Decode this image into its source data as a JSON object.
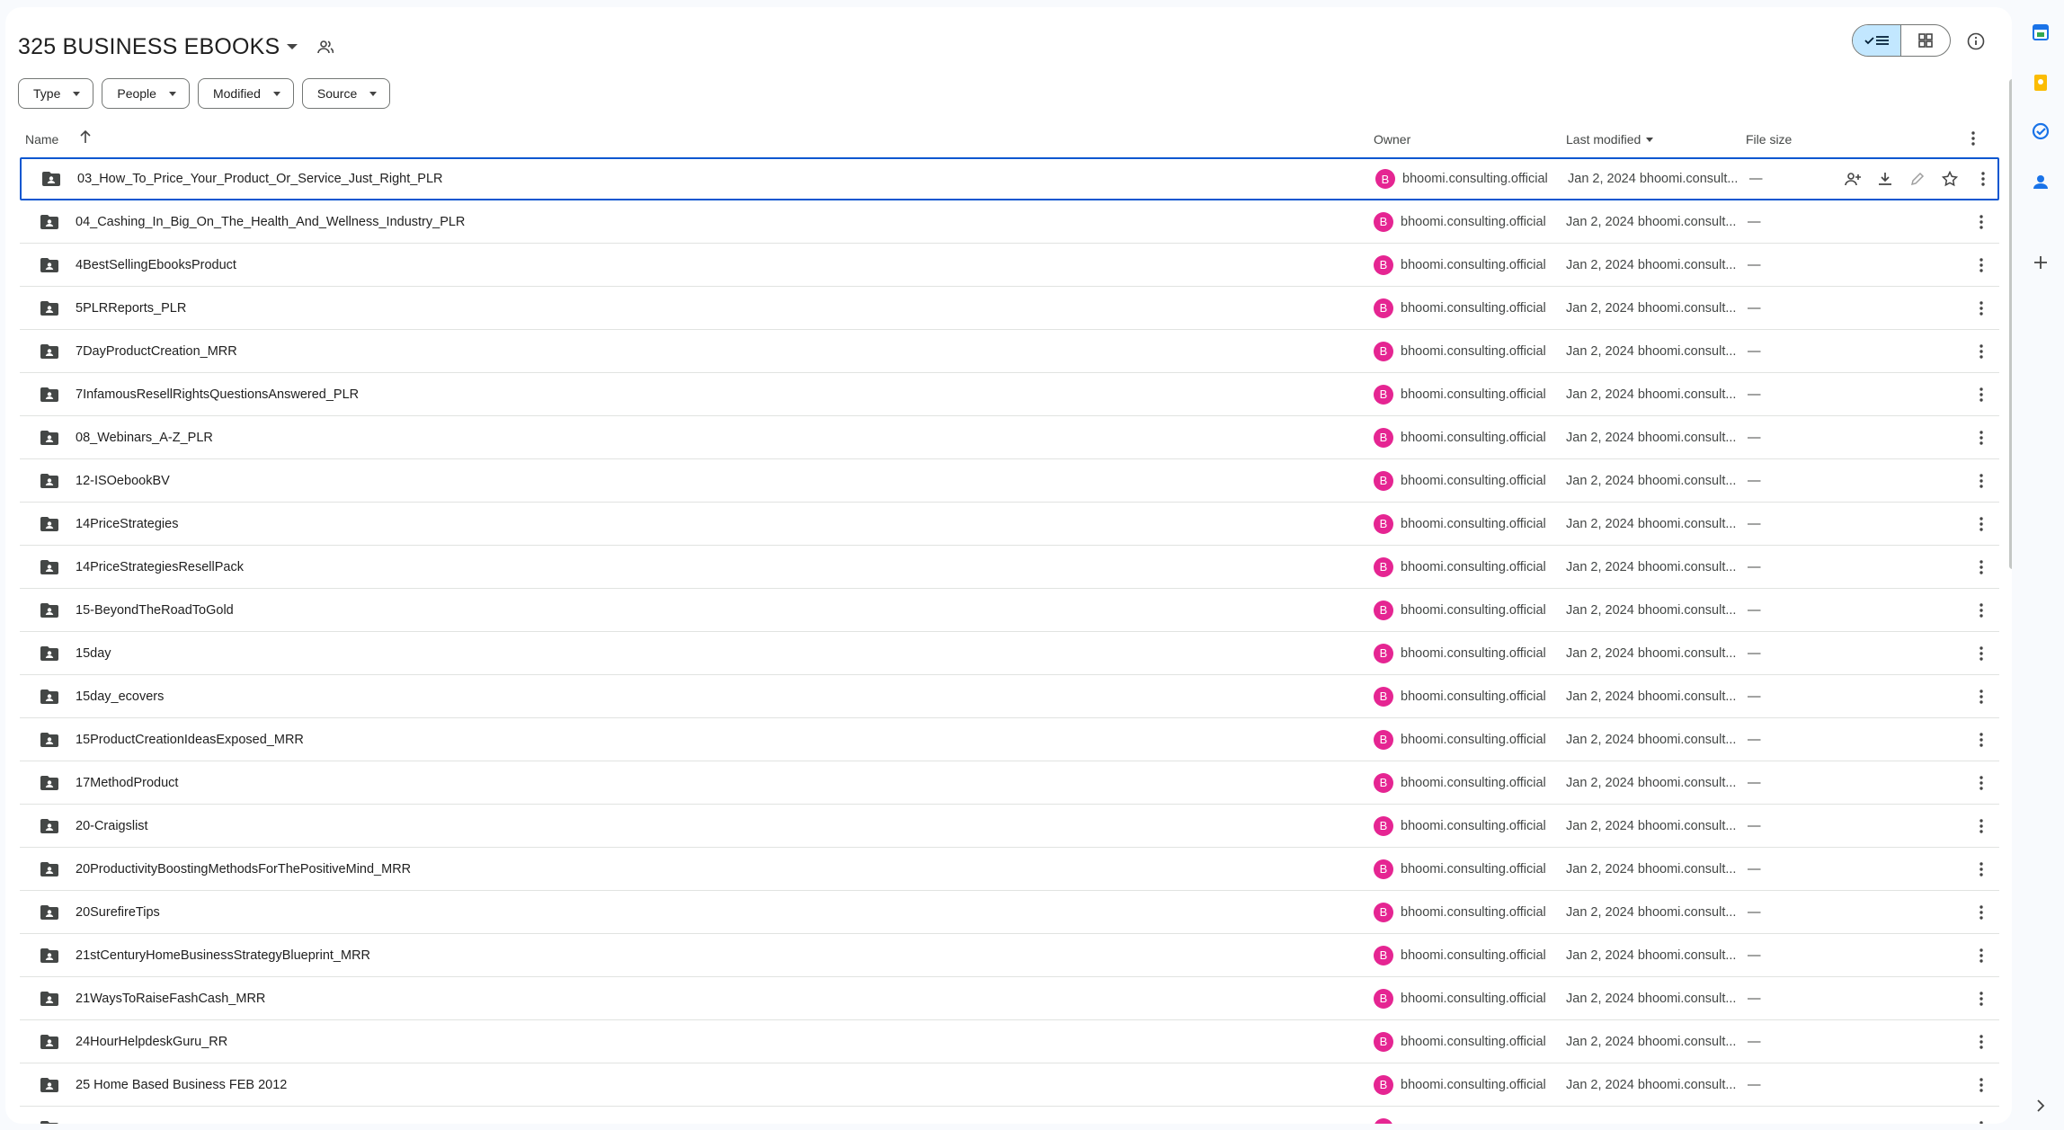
{
  "header": {
    "title": "325 BUSINESS EBOOKS"
  },
  "filters": [
    {
      "label": "Type"
    },
    {
      "label": "People"
    },
    {
      "label": "Modified"
    },
    {
      "label": "Source"
    }
  ],
  "columns": {
    "name": "Name",
    "owner": "Owner",
    "modified": "Last modified",
    "size": "File size"
  },
  "rows": [
    {
      "name": "03_How_To_Price_Your_Product_Or_Service_Just_Right_PLR",
      "avatar": "B",
      "owner": "bhoomi.consulting.official",
      "modified": "Jan 2, 2024 bhoomi.consult...",
      "size": "—"
    },
    {
      "name": "04_Cashing_In_Big_On_The_Health_And_Wellness_Industry_PLR",
      "avatar": "B",
      "owner": "bhoomi.consulting.official",
      "modified": "Jan 2, 2024 bhoomi.consult...",
      "size": "—"
    },
    {
      "name": "4BestSellingEbooksProduct",
      "avatar": "B",
      "owner": "bhoomi.consulting.official",
      "modified": "Jan 2, 2024 bhoomi.consult...",
      "size": "—"
    },
    {
      "name": "5PLRReports_PLR",
      "avatar": "B",
      "owner": "bhoomi.consulting.official",
      "modified": "Jan 2, 2024 bhoomi.consult...",
      "size": "—"
    },
    {
      "name": "7DayProductCreation_MRR",
      "avatar": "B",
      "owner": "bhoomi.consulting.official",
      "modified": "Jan 2, 2024 bhoomi.consult...",
      "size": "—"
    },
    {
      "name": "7InfamousResellRightsQuestionsAnswered_PLR",
      "avatar": "B",
      "owner": "bhoomi.consulting.official",
      "modified": "Jan 2, 2024 bhoomi.consult...",
      "size": "—"
    },
    {
      "name": "08_Webinars_A-Z_PLR",
      "avatar": "B",
      "owner": "bhoomi.consulting.official",
      "modified": "Jan 2, 2024 bhoomi.consult...",
      "size": "—"
    },
    {
      "name": "12-ISOebookBV",
      "avatar": "B",
      "owner": "bhoomi.consulting.official",
      "modified": "Jan 2, 2024 bhoomi.consult...",
      "size": "—"
    },
    {
      "name": "14PriceStrategies",
      "avatar": "B",
      "owner": "bhoomi.consulting.official",
      "modified": "Jan 2, 2024 bhoomi.consult...",
      "size": "—"
    },
    {
      "name": "14PriceStrategiesResellPack",
      "avatar": "B",
      "owner": "bhoomi.consulting.official",
      "modified": "Jan 2, 2024 bhoomi.consult...",
      "size": "—"
    },
    {
      "name": "15-BeyondTheRoadToGold",
      "avatar": "B",
      "owner": "bhoomi.consulting.official",
      "modified": "Jan 2, 2024 bhoomi.consult...",
      "size": "—"
    },
    {
      "name": "15day",
      "avatar": "B",
      "owner": "bhoomi.consulting.official",
      "modified": "Jan 2, 2024 bhoomi.consult...",
      "size": "—"
    },
    {
      "name": "15day_ecovers",
      "avatar": "B",
      "owner": "bhoomi.consulting.official",
      "modified": "Jan 2, 2024 bhoomi.consult...",
      "size": "—"
    },
    {
      "name": "15ProductCreationIdeasExposed_MRR",
      "avatar": "B",
      "owner": "bhoomi.consulting.official",
      "modified": "Jan 2, 2024 bhoomi.consult...",
      "size": "—"
    },
    {
      "name": "17MethodProduct",
      "avatar": "B",
      "owner": "bhoomi.consulting.official",
      "modified": "Jan 2, 2024 bhoomi.consult...",
      "size": "—"
    },
    {
      "name": "20-Craigslist",
      "avatar": "B",
      "owner": "bhoomi.consulting.official",
      "modified": "Jan 2, 2024 bhoomi.consult...",
      "size": "—"
    },
    {
      "name": "20ProductivityBoostingMethodsForThePositiveMind_MRR",
      "avatar": "B",
      "owner": "bhoomi.consulting.official",
      "modified": "Jan 2, 2024 bhoomi.consult...",
      "size": "—"
    },
    {
      "name": "20SurefireTips",
      "avatar": "B",
      "owner": "bhoomi.consulting.official",
      "modified": "Jan 2, 2024 bhoomi.consult...",
      "size": "—"
    },
    {
      "name": "21stCenturyHomeBusinessStrategyBlueprint_MRR",
      "avatar": "B",
      "owner": "bhoomi.consulting.official",
      "modified": "Jan 2, 2024 bhoomi.consult...",
      "size": "—"
    },
    {
      "name": "21WaysToRaiseFashCash_MRR",
      "avatar": "B",
      "owner": "bhoomi.consulting.official",
      "modified": "Jan 2, 2024 bhoomi.consult...",
      "size": "—"
    },
    {
      "name": "24HourHelpdeskGuru_RR",
      "avatar": "B",
      "owner": "bhoomi.consulting.official",
      "modified": "Jan 2, 2024 bhoomi.consult...",
      "size": "—"
    },
    {
      "name": "25 Home Based Business FEB 2012",
      "avatar": "B",
      "owner": "bhoomi.consulting.official",
      "modified": "Jan 2, 2024 bhoomi.consult...",
      "size": "—"
    },
    {
      "name": "",
      "avatar": "B",
      "owner": "",
      "modified": "",
      "size": ""
    }
  ],
  "colors": {
    "selection": "#0b57d0",
    "avatar": "#e52592",
    "toggle_active": "#c2e7ff"
  },
  "icons": {
    "folder": "shared-folder-icon",
    "share": "add-person-icon",
    "download": "download-icon",
    "rename": "pencil-icon",
    "star": "star-icon",
    "more": "more-vert-icon"
  }
}
